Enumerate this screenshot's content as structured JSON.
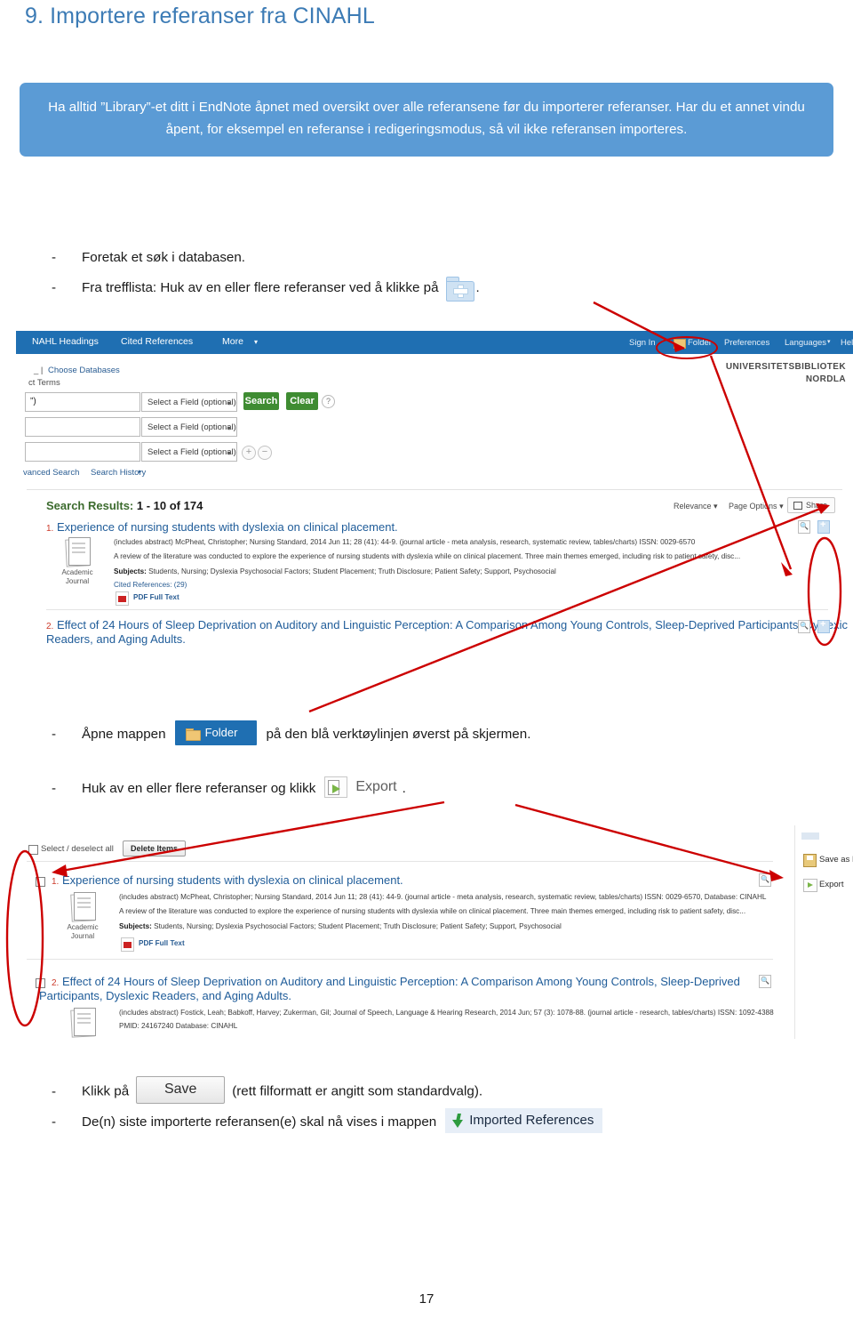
{
  "document": {
    "title": "9. Importere referanser fra CINAHL",
    "page_number": "17",
    "accent_color": "#3c7bb5",
    "callout_color": "#5b9bd5",
    "annotation_color": "#cc0000"
  },
  "callout": {
    "text": "Ha alltid ”Library”-et ditt i EndNote åpnet med oversikt over alle referansene før du importerer referanser. Har du et annet vindu åpent, for eksempel en referanse i redigeringsmodus, så vil ikke referansen importeres."
  },
  "steps": {
    "dash": "-",
    "step1": "Foretak et søk i databasen.",
    "step2": "Fra trefflista: Huk av en eller flere referanser ved å klikke på",
    "step2_end": ".",
    "step3_pre": "Åpne mappen",
    "step3_post": "på den blå verktøylinjen øverst på skjermen.",
    "step4_pre": "Huk av en eller flere referanser og klikk",
    "step4_post": ".",
    "step5_pre": "Klikk på",
    "step5_post": "(rett filformatt er angitt som standardvalg).",
    "step6_pre": "De(n) siste importerte referansen(e) skal nå vises i mappen",
    "folder_button_label": "Folder",
    "export_chip_label": "Export",
    "save_button_label": "Save",
    "imported_chip_label": "Imported References"
  },
  "screenshot1": {
    "topbar": {
      "nav": [
        "NAHL Headings",
        "Cited References",
        "More"
      ],
      "more_caret": "▾",
      "right": [
        "Sign In",
        "Folder",
        "Preferences",
        "Languages",
        "Help"
      ],
      "languages_caret": "▾"
    },
    "library": [
      "UNIVERSITETSBIBLIOTEK",
      "NORDLA"
    ],
    "links": {
      "choose_databases": "Choose Databases",
      "subject_terms": "ct Terms",
      "advanced_search": "vanced Search",
      "search_history": "Search History",
      "search_history_caret": "▸"
    },
    "search_form": {
      "query_value": "”)",
      "field_select": "Select a Field (optional)",
      "field_caret": "▾",
      "search_button": "Search",
      "clear_button": "Clear",
      "help_glyph": "?",
      "add_row": "+",
      "remove_row": "−"
    },
    "results": {
      "heading_label": "Search Results:",
      "heading_range": "1 - 10 of 174",
      "sort_by": "Relevance",
      "page_options": "Page Options",
      "share": "Share",
      "caret": "▾",
      "items": [
        {
          "number": "1.",
          "title": "Experience of nursing students with dyslexia on clinical placement.",
          "citation": "(includes abstract) McPheat, Christopher; Nursing Standard, 2014 Jun 11; 28 (41): 44-9. (journal article - meta analysis, research, systematic review, tables/charts) ISSN: 0029-6570",
          "abstract": "A review of the literature was conducted to explore the experience of nursing students with dyslexia while on clinical placement. Three main themes emerged, including risk to patient safety, disc...",
          "subjects_label": "Subjects:",
          "subjects": "Students, Nursing; Dyslexia Psychosocial Factors; Student Placement; Truth Disclosure; Patient Safety; Support, Psychosocial",
          "cited_references": "Cited References: (29)",
          "pdf_link": "PDF Full Text",
          "source_type_line1": "Academic",
          "source_type_line2": "Journal"
        },
        {
          "number": "2.",
          "title_line1": "Effect of 24 Hours of Sleep Deprivation on Auditory and Linguistic Perception: A Comparison Among Young Controls, Sleep-Deprived Participants, Dyslexic",
          "title_line2": "Readers, and Aging Adults."
        }
      ]
    }
  },
  "screenshot2": {
    "toolbar": {
      "select_all": "Select / deselect all",
      "delete_items": "Delete Items"
    },
    "sidepanel": {
      "save_as_file": "Save as File",
      "export": "Export"
    },
    "items": [
      {
        "number": "1.",
        "title": "Experience of nursing students with dyslexia on clinical placement.",
        "citation": "(includes abstract) McPheat, Christopher; Nursing Standard, 2014 Jun 11; 28 (41): 44-9. (journal article - meta analysis, research, systematic review, tables/charts) ISSN: 0029-6570, Database: CINAHL",
        "abstract": "A review of the literature was conducted to explore the experience of nursing students with dyslexia while on clinical placement. Three main themes emerged, including risk to patient safety, disc...",
        "subjects_label": "Subjects:",
        "subjects": "Students, Nursing; Dyslexia Psychosocial Factors; Student Placement; Truth Disclosure; Patient Safety; Support, Psychosocial",
        "pdf_link": "PDF Full Text",
        "source_type_line1": "Academic",
        "source_type_line2": "Journal"
      },
      {
        "number": "2.",
        "title_line1": "Effect of 24 Hours of Sleep Deprivation on Auditory and Linguistic Perception: A Comparison Among Young Controls, Sleep-Deprived",
        "title_line2": "Participants, Dyslexic Readers, and Aging Adults.",
        "citation": "(includes abstract) Fostick, Leah; Babkoff, Harvey; Zukerman, Gil; Journal of Speech, Language & Hearing Research, 2014 Jun; 57 (3): 1078-88. (journal article - research, tables/charts) ISSN: 1092-4388",
        "citation2": "PMID: 24167240 Database: CINAHL"
      }
    ]
  }
}
